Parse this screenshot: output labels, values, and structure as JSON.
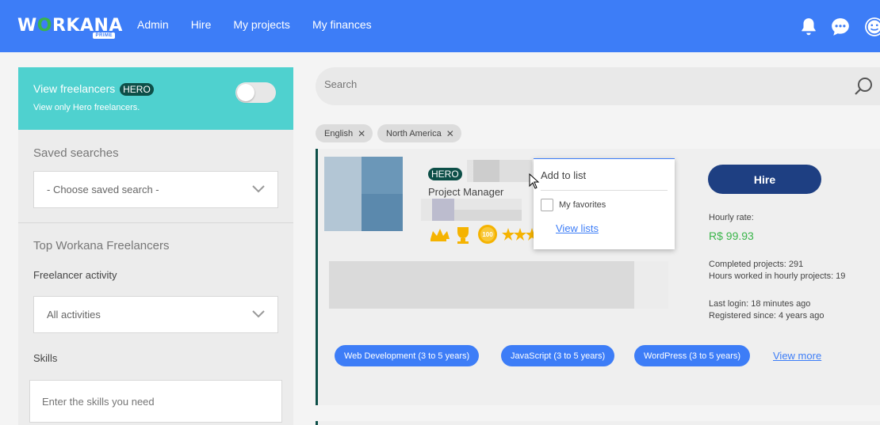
{
  "header": {
    "logo_text_a": "W",
    "logo_text_o": "O",
    "logo_text_b": "RKANA",
    "logo_badge": "PRIME",
    "nav": [
      "Admin",
      "Hire",
      "My projects",
      "My finances"
    ],
    "accent": "#3d7df7"
  },
  "sidebar": {
    "hero_title": "View freelancers",
    "hero_badge": "HERO",
    "hero_sub": "View only Hero freelancers.",
    "saved_searches_label": "Saved searches",
    "saved_search_value": "- Choose saved search -",
    "top_label": "Top Workana Freelancers",
    "activity_label": "Freelancer activity",
    "activity_value": "All activities",
    "skills_label": "Skills",
    "skills_placeholder": "Enter the skills you need"
  },
  "search": {
    "placeholder": "Search"
  },
  "filters": [
    "English",
    "North America"
  ],
  "card": {
    "hero_badge": "HERO",
    "role": "Project Manager",
    "badge_100": "100",
    "hire_label": "Hire",
    "hourly_label": "Hourly rate:",
    "hourly_rate": "R$ 99.93",
    "completed": "Completed projects: 291",
    "hours": "Hours worked in hourly projects: 19",
    "last_login": "Last login: 18 minutes ago",
    "registered": "Registered since: 4 years ago",
    "skills": [
      "Web Development (3 to 5 years)",
      "JavaScript (3 to 5 years)",
      "WordPress (3 to 5 years)"
    ],
    "view_more": "View more"
  },
  "dropdown": {
    "title": "Add to list",
    "favorites": "My favorites",
    "view_lists": "View lists"
  }
}
